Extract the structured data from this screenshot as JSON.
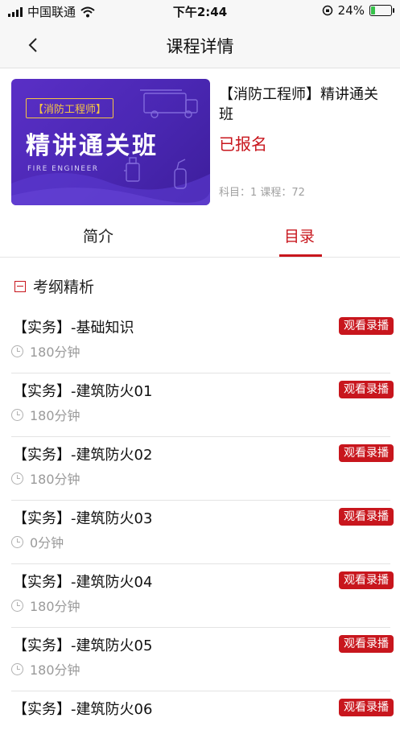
{
  "status_bar": {
    "carrier": "中国联通",
    "time": "下午2:44",
    "battery": "24%",
    "battery_level": 0.24
  },
  "nav": {
    "title": "课程详情",
    "back_icon": "chevron-left-icon"
  },
  "course": {
    "cover": {
      "tag": "【消防工程师】",
      "title": "精讲通关班",
      "subtitle": "FIRE ENGINEER"
    },
    "name": "【消防工程师】精讲通关班",
    "enrolled_label": "已报名",
    "meta": "科目：1   课程：72"
  },
  "tabs": [
    {
      "label": "简介",
      "active": false
    },
    {
      "label": "目录",
      "active": true
    }
  ],
  "section": {
    "title": "考纲精析",
    "icon": "collapse-icon"
  },
  "lessons": [
    {
      "title": "【实务】-基础知识",
      "duration": "180分钟",
      "action": "观看录播"
    },
    {
      "title": "【实务】-建筑防火01",
      "duration": "180分钟",
      "action": "观看录播"
    },
    {
      "title": "【实务】-建筑防火02",
      "duration": "180分钟",
      "action": "观看录播"
    },
    {
      "title": "【实务】-建筑防火03",
      "duration": "0分钟",
      "action": "观看录播"
    },
    {
      "title": "【实务】-建筑防火04",
      "duration": "180分钟",
      "action": "观看录播"
    },
    {
      "title": "【实务】-建筑防火05",
      "duration": "180分钟",
      "action": "观看录播"
    },
    {
      "title": "【实务】-建筑防火06",
      "duration": "",
      "action": "观看录播"
    }
  ],
  "colors": {
    "accent": "#c8161d",
    "cover_bg": "#4a27b3",
    "cover_tag": "#f5c542"
  }
}
